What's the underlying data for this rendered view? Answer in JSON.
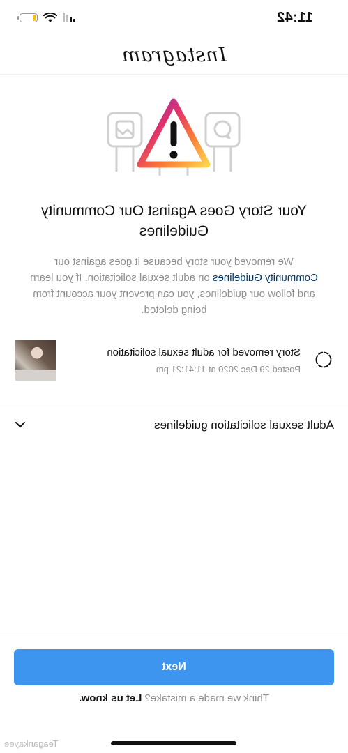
{
  "status_bar": {
    "time": "11:42",
    "battery_level": 0.2,
    "colors": {
      "battery": "#f2c200"
    }
  },
  "header": {
    "logo": "Instagram"
  },
  "notice": {
    "title": "Your Story Goes Against Our Community Guidelines",
    "body_before_link": "We removed your story because it goes against our ",
    "body_link": "Community Guidelines",
    "body_after_link": " on adult sexual solicitation. If you learn and follow our guidelines, you can prevent your account from being deleted."
  },
  "story": {
    "title": "Story removed for adult sexual solicitation",
    "posted": "Posted 29 Dec 2020 at 11:41:21 pm"
  },
  "guidelines": {
    "label": "Adult sexual solicitation guidelines",
    "expanded": false
  },
  "actions": {
    "next_label": "Next",
    "mistake_prefix": "Think we made a mistake? ",
    "mistake_link": "Let us know."
  },
  "watermark": "Teagankayee",
  "colors": {
    "primary_button": "#3e95ef",
    "link": "#00376b",
    "secondary_text": "#8e8e8e"
  }
}
